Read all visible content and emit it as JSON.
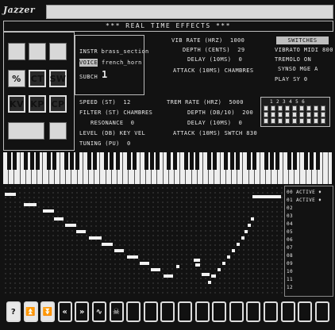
{
  "app": {
    "logo": "Jazzer",
    "header": "*** REAL TIME EFFECTS ***"
  },
  "tool_icons": [
    {
      "name": "disk-icon",
      "label": ""
    },
    {
      "name": "face-icon",
      "label": ""
    },
    {
      "name": "blank-icon",
      "label": ""
    },
    {
      "name": "percent-icon",
      "label": "%"
    },
    {
      "name": "ct-button",
      "label": "CT"
    },
    {
      "name": "sw-button",
      "label": "SW"
    },
    {
      "name": "kv-button",
      "label": "KV"
    },
    {
      "name": "kp-button",
      "label": "KP"
    },
    {
      "name": "cp-button",
      "label": "CP"
    },
    {
      "name": "cursor-keys-icon",
      "label": ""
    },
    {
      "name": "piano-icon",
      "label": ""
    }
  ],
  "instrument": {
    "instr_line": "INSTR brass_section",
    "voice_label": "VOICE",
    "voice_value": "french_horn",
    "subch_label": "SUBCH",
    "subch_value": "1"
  },
  "vibrato": {
    "rate": "VIB RATE (HRZ)  1000",
    "depth": "DEPTH (CENTS)  29",
    "delay": "DELAY (10MS)  0",
    "attack": "ATTACK (10MS) CHAMBRES"
  },
  "switches": {
    "header": "SWITCHES",
    "vibrato": "VIBRATO MIDI 800",
    "tremolo": "TREMOLO ON",
    "synso": "SYNSO MGE A",
    "play": "PLAY SY 0"
  },
  "filter": {
    "speed": "SPEED (ST)  12",
    "filter": "FILTER (ST) CHAMBRES",
    "resonance": "RESONANCE  0",
    "level": "LEVEL (DB) KEY VEL",
    "tuning": "TUNING (PU)  0"
  },
  "tremolo": {
    "rate": "TREM RATE (HRZ)  5000",
    "depth": "DEPTH (DB/10)  200",
    "delay": "DELAY (10MS)  0",
    "attack": "ATTACK (10MS) SWTCH 830"
  },
  "matrix_header": "1 2 3 4 5 6",
  "channels": [
    "00 ACTIVE ♦",
    "01 ACTIVE ♦",
    "02",
    "03",
    "04",
    "05",
    "06",
    "07",
    "08",
    "09",
    "10",
    "11",
    "12"
  ],
  "toolbar": [
    {
      "name": "help-button",
      "glyph": "?"
    },
    {
      "name": "scroll-up-button",
      "glyph": "⏫"
    },
    {
      "name": "scroll-down-button",
      "glyph": "⏬"
    },
    {
      "name": "rewind-button",
      "glyph": "«"
    },
    {
      "name": "forward-button",
      "glyph": "»"
    },
    {
      "name": "wave-button",
      "glyph": "∿"
    },
    {
      "name": "bug-button",
      "glyph": "☠"
    }
  ]
}
